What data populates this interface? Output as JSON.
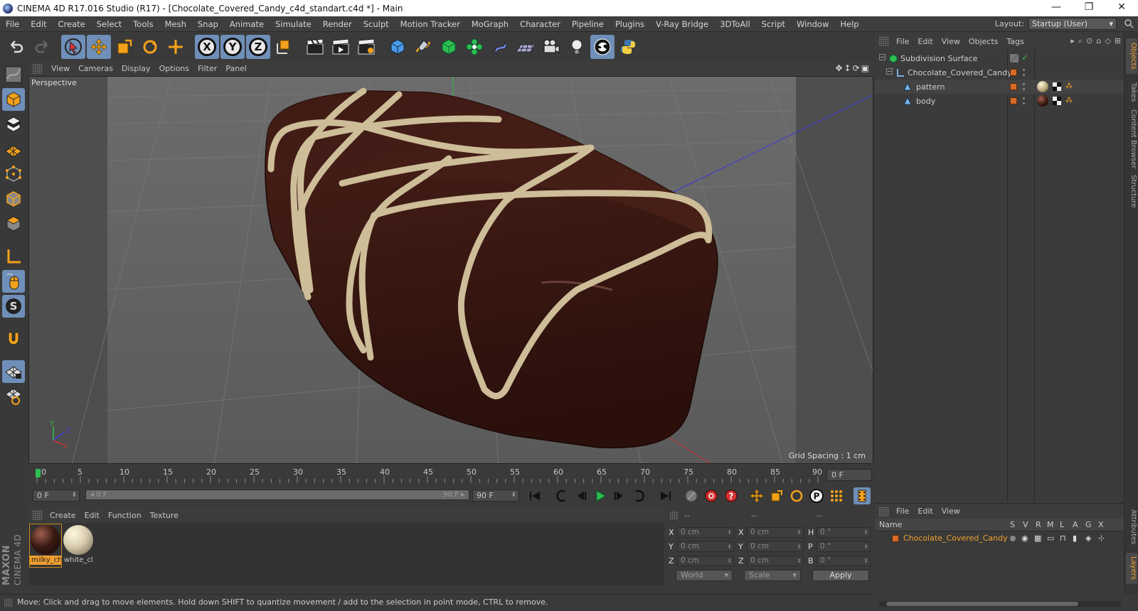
{
  "window": {
    "title": "CINEMA 4D R17.016 Studio (R17) - [Chocolate_Covered_Candy_c4d_standart.c4d *] - Main",
    "controls": [
      "—",
      "❐",
      "✕"
    ]
  },
  "menubar": {
    "items": [
      "File",
      "Edit",
      "Create",
      "Select",
      "Tools",
      "Mesh",
      "Snap",
      "Animate",
      "Simulate",
      "Render",
      "Sculpt",
      "Motion Tracker",
      "MoGraph",
      "Character",
      "Pipeline",
      "Plugins",
      "V-Ray Bridge",
      "3DToAll",
      "Script",
      "Window",
      "Help"
    ],
    "layout_label": "Layout:",
    "layout_value": "Startup (User)"
  },
  "toolbar": {
    "axis_x": "X",
    "axis_y": "Y",
    "axis_z": "Z"
  },
  "viewport": {
    "menu": [
      "View",
      "Cameras",
      "Display",
      "Options",
      "Filter",
      "Panel"
    ],
    "camera_label": "Perspective",
    "grid_spacing": "Grid Spacing : 1 cm",
    "axis_x": "X",
    "axis_y": "Y",
    "axis_z": "Z"
  },
  "timeline": {
    "ticks": [
      "0",
      "5",
      "10",
      "15",
      "20",
      "25",
      "30",
      "35",
      "40",
      "45",
      "50",
      "55",
      "60",
      "65",
      "70",
      "75",
      "80",
      "85",
      "90"
    ],
    "current_frame": "0 F"
  },
  "transport": {
    "start_field": "0 F",
    "slider_left": "◂ 0 F",
    "slider_right": "90 F ▸",
    "end_field": "90 F"
  },
  "material_manager": {
    "menu": [
      "Create",
      "Edit",
      "Function",
      "Texture"
    ],
    "materials": [
      {
        "name": "milky_ch",
        "selected": true,
        "color": "#3a1a12"
      },
      {
        "name": "white_cl",
        "selected": false,
        "color": "#d9cdb0"
      }
    ]
  },
  "coordinates": {
    "header": [
      "--",
      "--",
      "--"
    ],
    "rows": [
      {
        "a": "X",
        "av": "0 cm",
        "b": "X",
        "bv": "0 cm",
        "c": "H",
        "cv": "0 °"
      },
      {
        "a": "Y",
        "av": "0 cm",
        "b": "Y",
        "bv": "0 cm",
        "c": "P",
        "cv": "0 °"
      },
      {
        "a": "Z",
        "av": "0 cm",
        "b": "Z",
        "bv": "0 cm",
        "c": "B",
        "cv": "0 °"
      }
    ],
    "space": "World",
    "mode": "Scale",
    "apply": "Apply"
  },
  "status": "Move: Click and drag to move elements. Hold down SHIFT to quantize movement / add to the selection in point mode, CTRL to remove.",
  "object_manager": {
    "menu": [
      "File",
      "Edit",
      "View",
      "Objects",
      "Tags"
    ],
    "objects": [
      {
        "name": "Subdivision Surface",
        "indent": 0
      },
      {
        "name": "Chocolate_Covered_Candy",
        "indent": 1
      },
      {
        "name": "pattern",
        "indent": 2
      },
      {
        "name": "body",
        "indent": 2
      }
    ]
  },
  "right_tabs": [
    "Objects",
    "Takes",
    "Content Browser",
    "Structure"
  ],
  "right_tabs_bottom": [
    "Attributes",
    "Layers"
  ],
  "layer_manager": {
    "menu": [
      "File",
      "Edit",
      "View"
    ],
    "columns": [
      "Name",
      "S",
      "V",
      "R",
      "M",
      "L",
      "A",
      "G",
      "X"
    ],
    "layer": "Chocolate_Covered_Candy"
  },
  "maxon": {
    "brand": "MAXON",
    "product": "CINEMA 4D"
  },
  "colors": {
    "accent_blue": "#6f8fb8",
    "selection_orange": "#f0a030",
    "chocolate": "#3a1a12",
    "cream": "#d9cdb0"
  }
}
